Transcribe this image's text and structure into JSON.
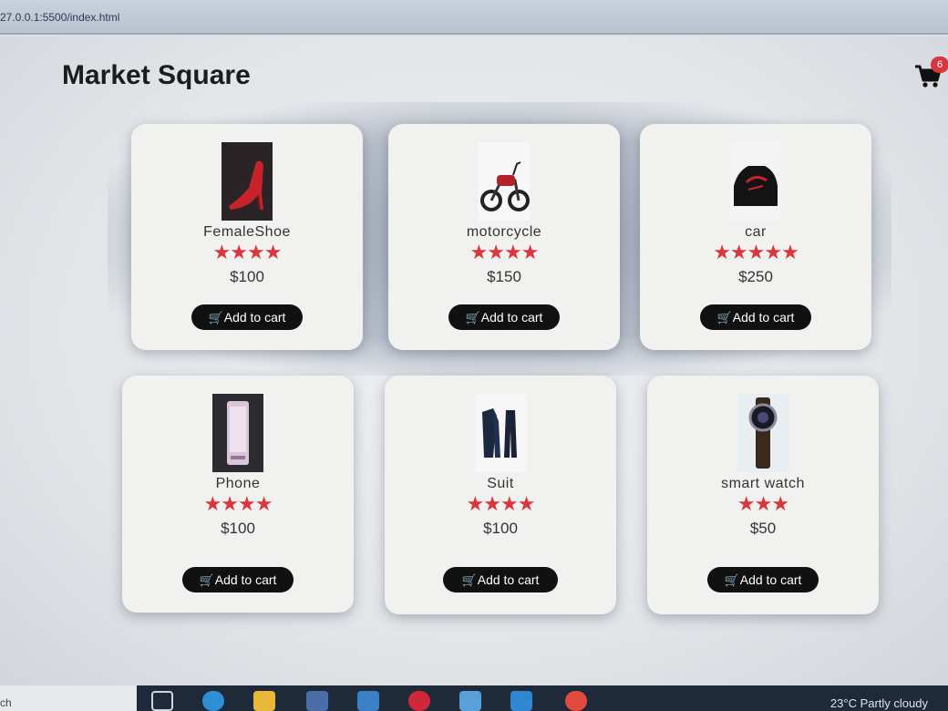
{
  "browser": {
    "url": "27.0.0.1:5500/index.html"
  },
  "header": {
    "title": "Market Square"
  },
  "cart": {
    "count": "6",
    "icon": "shopping-cart-icon"
  },
  "colors": {
    "accent": "#d9363e",
    "button": "#111111",
    "card": "#f1f2ef"
  },
  "products": [
    {
      "name": "FemaleShoe",
      "stars": "★★★★",
      "rating": 4,
      "price": "$100",
      "button": "Add to cart",
      "image": "red-high-heel-shoe"
    },
    {
      "name": "motorcycle",
      "stars": "★★★★",
      "rating": 4,
      "price": "$150",
      "button": "Add to cart",
      "image": "red-motorcycle"
    },
    {
      "name": "car",
      "stars": "★★★★★",
      "rating": 5,
      "price": "$250",
      "button": "Add to cart",
      "image": "red-black-car"
    },
    {
      "name": "Phone",
      "stars": "★★★★",
      "rating": 4,
      "price": "$100",
      "button": "Add to cart",
      "image": "smartphone"
    },
    {
      "name": "Suit",
      "stars": "★★★★",
      "rating": 4,
      "price": "$100",
      "button": "Add to cart",
      "image": "dark-suit"
    },
    {
      "name": "smart watch",
      "stars": "★★★",
      "rating": 3,
      "price": "$50",
      "button": "Add to cart",
      "image": "smart-watch"
    }
  ],
  "taskbar": {
    "left_text": "ch",
    "weather": "23°C  Partly cloudy"
  }
}
